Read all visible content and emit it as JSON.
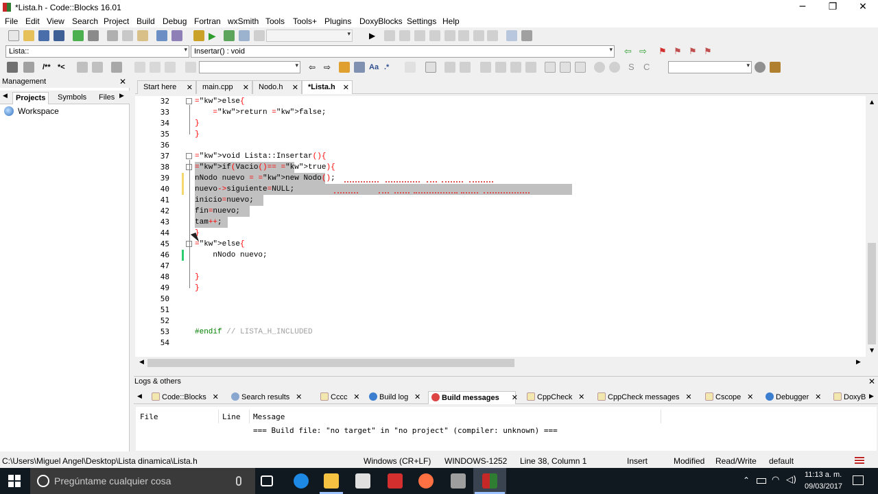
{
  "window": {
    "title": "*Lista.h - Code::Blocks 16.01"
  },
  "menu": [
    "File",
    "Edit",
    "View",
    "Search",
    "Project",
    "Build",
    "Debug",
    "Fortran",
    "wxSmith",
    "Tools",
    "Tools+",
    "Plugins",
    "DoxyBlocks",
    "Settings",
    "Help"
  ],
  "toolbar": {
    "scope_combo": "Lista::",
    "function_combo": "Insertar() : void"
  },
  "management": {
    "title": "Management",
    "tabs": [
      "Projects",
      "Symbols",
      "Files"
    ],
    "tree_root": "Workspace"
  },
  "editor_tabs": [
    {
      "label": "Start here"
    },
    {
      "label": "main.cpp"
    },
    {
      "label": "Nodo.h"
    },
    {
      "label": "*Lista.h",
      "active": true
    }
  ],
  "code_lines": [
    {
      "n": "32",
      "text": "else{"
    },
    {
      "n": "33",
      "text": "    return false;"
    },
    {
      "n": "34",
      "text": "}"
    },
    {
      "n": "35",
      "text": "}"
    },
    {
      "n": "36",
      "text": ""
    },
    {
      "n": "37",
      "text": "void Lista::Insertar(){"
    },
    {
      "n": "38",
      "text": "if(Vacio()== true){"
    },
    {
      "n": "39",
      "text": "nNodo nuevo = new Nodo();"
    },
    {
      "n": "40",
      "text": "nuevo->siguiente=NULL;"
    },
    {
      "n": "41",
      "text": "inicio=nuevo;"
    },
    {
      "n": "42",
      "text": "fin=nuevo;"
    },
    {
      "n": "43",
      "text": "tam++;"
    },
    {
      "n": "44",
      "text": "}"
    },
    {
      "n": "45",
      "text": "else{"
    },
    {
      "n": "46",
      "text": "    nNodo nuevo;"
    },
    {
      "n": "47",
      "text": ""
    },
    {
      "n": "48",
      "text": "}"
    },
    {
      "n": "49",
      "text": "}"
    },
    {
      "n": "50",
      "text": ""
    },
    {
      "n": "51",
      "text": ""
    },
    {
      "n": "52",
      "text": ""
    },
    {
      "n": "53",
      "text": "#endif // LISTA_H_INCLUDED"
    },
    {
      "n": "54",
      "text": ""
    }
  ],
  "logs": {
    "title": "Logs & others",
    "tabs": [
      "Code::Blocks",
      "Search results",
      "Cccc",
      "Build log",
      "Build messages",
      "CppCheck",
      "CppCheck messages",
      "Cscope",
      "Debugger",
      "DoxyB"
    ],
    "active_tab": "Build messages",
    "columns": [
      "File",
      "Line",
      "Message"
    ],
    "message": "=== Build file: \"no target\" in \"no project\" (compiler: unknown) ==="
  },
  "status": {
    "path": "C:\\Users\\Miguel Angel\\Desktop\\Lista dinamica\\Lista.h",
    "eol": "Windows (CR+LF)",
    "encoding": "WINDOWS-1252",
    "position": "Line 38, Column 1",
    "mode": "Insert",
    "modified": "Modified",
    "access": "Read/Write",
    "profile": "default"
  },
  "taskbar": {
    "search_placeholder": "Pregúntame cualquier cosa",
    "time": "11:13 a. m.",
    "date": "09/03/2017"
  }
}
